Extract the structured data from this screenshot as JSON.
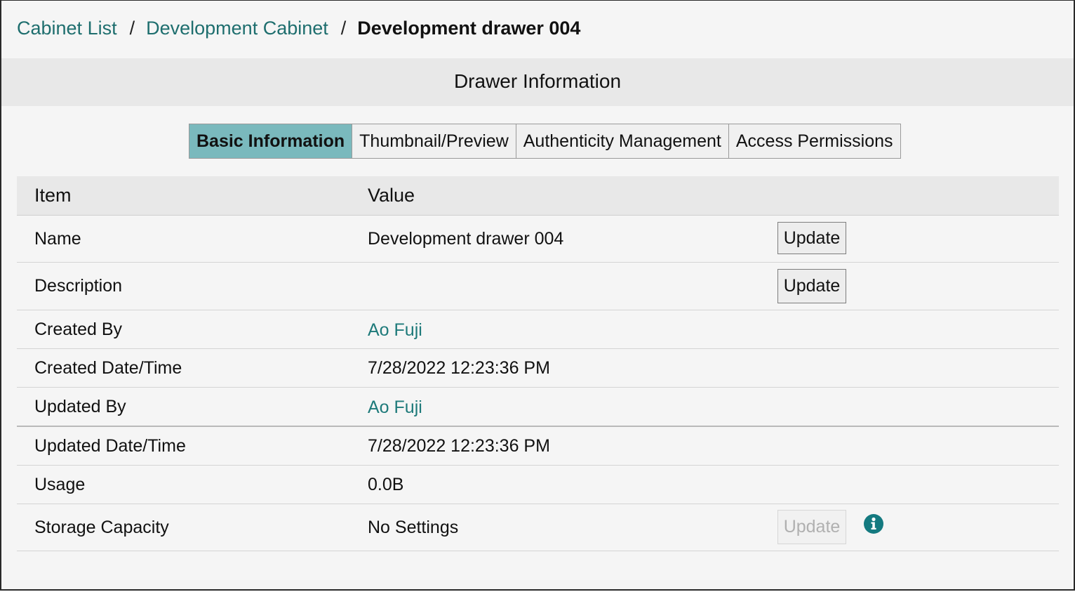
{
  "breadcrumb": {
    "items": [
      "Cabinet List",
      "Development Cabinet"
    ],
    "separator": "/",
    "current": "Development drawer 004"
  },
  "section_title": "Drawer Information",
  "tabs": [
    {
      "label": "Basic Information",
      "active": true
    },
    {
      "label": "Thumbnail/Preview",
      "active": false
    },
    {
      "label": "Authenticity Management",
      "active": false
    },
    {
      "label": "Access Permissions",
      "active": false
    }
  ],
  "table": {
    "headers": {
      "item": "Item",
      "value": "Value"
    },
    "rows": [
      {
        "item": "Name",
        "value": "Development drawer 004",
        "button": "Update"
      },
      {
        "item": "Description",
        "value": "",
        "button": "Update"
      },
      {
        "item": "Created By",
        "value": "Ao Fuji"
      },
      {
        "item": "Created Date/Time",
        "value": "7/28/2022 12:23:36 PM"
      },
      {
        "item": "Updated By",
        "value": "Ao Fuji"
      },
      {
        "item": "Updated Date/Time",
        "value": "7/28/2022 12:23:36 PM"
      },
      {
        "item": "Usage",
        "value": "0.0B"
      },
      {
        "item": "Storage Capacity",
        "value": "No Settings",
        "button": "Update",
        "button_disabled": true,
        "icon": "info-icon"
      }
    ]
  },
  "colors": {
    "link": "#1e7a7a",
    "active_tab": "#7ab9bd",
    "info_icon": "#147a80"
  }
}
